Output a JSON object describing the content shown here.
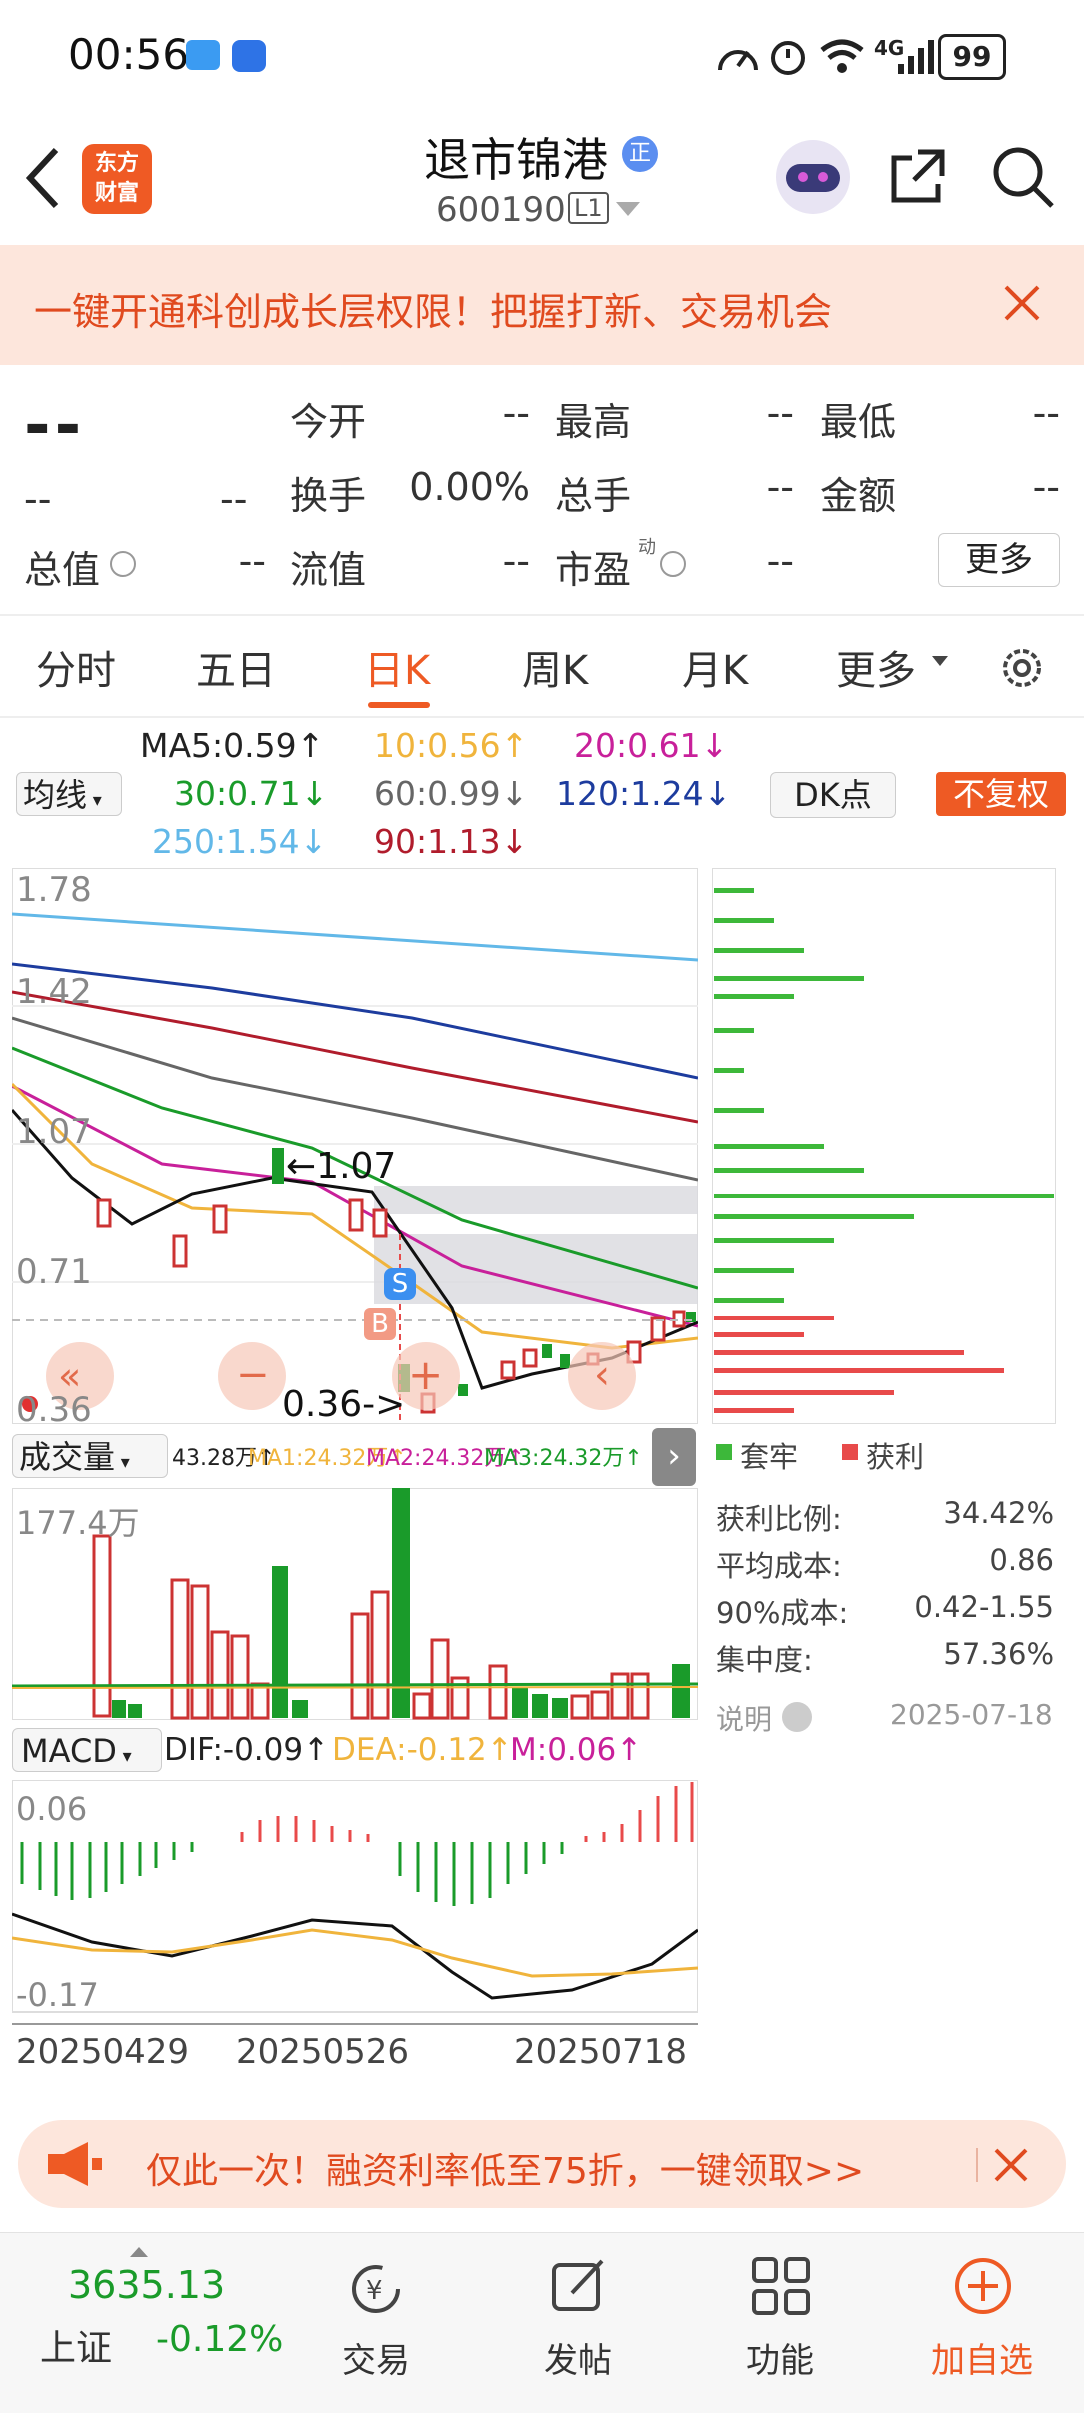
{
  "status": {
    "time": "00:56",
    "battery": "99",
    "network": "4G"
  },
  "header": {
    "stock_name": "退市锦港",
    "stock_code": "600190",
    "level": "L1",
    "brand_line1": "东方",
    "brand_line2": "财富",
    "tag": "正"
  },
  "promo": {
    "text": "一键开通科创成长层权限！把握打新、交易机会"
  },
  "quote": {
    "price": "--",
    "change": "--",
    "change_pct": "--",
    "rows": [
      [
        {
          "label": "今开",
          "value": "--"
        },
        {
          "label": "最高",
          "value": "--"
        },
        {
          "label": "最低",
          "value": "--"
        }
      ],
      [
        {
          "label": "换手",
          "value": "0.00%"
        },
        {
          "label": "总手",
          "value": "--"
        },
        {
          "label": "金额",
          "value": "--"
        }
      ],
      [
        {
          "label": "总值",
          "value": "--"
        },
        {
          "label": "流值",
          "value": "--"
        },
        {
          "label": "市盈",
          "value": "--"
        }
      ]
    ],
    "pe_super": "动",
    "more": "更多"
  },
  "tabs": [
    "分时",
    "五日",
    "日K",
    "周K",
    "月K",
    "更多"
  ],
  "active_tab": "日K",
  "ma_legend": {
    "selector": "均线",
    "items": [
      {
        "text": "MA5:0.59↑",
        "color": "#222222"
      },
      {
        "text": "10:0.56↑",
        "color": "#f0b43c"
      },
      {
        "text": "20:0.61↓",
        "color": "#c8209a"
      },
      {
        "text": "30:0.71↓",
        "color": "#1a9b2a"
      },
      {
        "text": "60:0.99↓",
        "color": "#666666"
      },
      {
        "text": "120:1.24↓",
        "color": "#1d3c9e"
      },
      {
        "text": "250:1.54↓",
        "color": "#62b8e8"
      },
      {
        "text": "90:1.13↓",
        "color": "#b01c2c"
      }
    ],
    "dk_button": "DK点",
    "adjust_button": "不复权"
  },
  "kline": {
    "y_labels": [
      "1.78",
      "1.42",
      "1.07",
      "0.71",
      "0.36"
    ],
    "high_annotation": "←1.07",
    "low_annotation": "0.36->",
    "sell_marker": "S",
    "buy_marker": "B"
  },
  "chips": {
    "legend": [
      {
        "label": "套牢",
        "color": "#3db83a"
      },
      {
        "label": "获利",
        "color": "#e84a4a"
      }
    ],
    "stats": [
      {
        "label": "获利比例:",
        "value": "34.42%"
      },
      {
        "label": "平均成本:",
        "value": "0.86"
      },
      {
        "label": "90%成本:",
        "value": "0.42-1.55"
      },
      {
        "label": "集中度:",
        "value": "57.36%"
      }
    ],
    "note": "说明",
    "date": "2025-07-18"
  },
  "volume": {
    "selector": "成交量",
    "legend": [
      {
        "text": "43.28万↑",
        "color": "#222222"
      },
      {
        "text": "MA1:24.32万↑",
        "color": "#f0b43c"
      },
      {
        "text": "MA2:24.32万↑",
        "color": "#c8209a"
      },
      {
        "text": "MA3:24.32万↑",
        "color": "#1a9b2a"
      }
    ],
    "max_label": "177.4万"
  },
  "macd": {
    "selector": "MACD",
    "legend": [
      {
        "text": "DIF:-0.09↑",
        "color": "#222222"
      },
      {
        "text": "DEA:-0.12↑",
        "color": "#f0b43c"
      },
      {
        "text": "M:0.06↑",
        "color": "#c8209a"
      }
    ],
    "y_top": "0.06",
    "y_bottom": "-0.17",
    "dates": [
      "20250429",
      "20250526",
      "20250718"
    ]
  },
  "promo2": {
    "text": "仅此一次！融资利率低至75折，一键领取>>"
  },
  "bottom": {
    "index_value": "3635.13",
    "index_name": "上证",
    "index_change": "-0.12%",
    "items": [
      "交易",
      "发帖",
      "功能",
      "加自选"
    ]
  }
}
